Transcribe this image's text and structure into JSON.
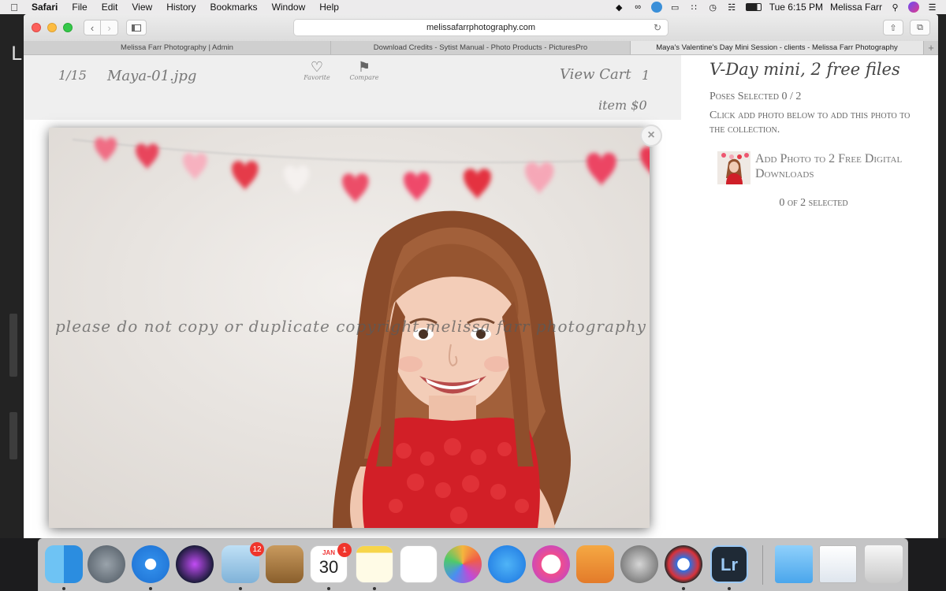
{
  "menubar": {
    "apple_icon": "apple-logo",
    "items": [
      "Safari",
      "File",
      "Edit",
      "View",
      "History",
      "Bookmarks",
      "Window",
      "Help"
    ],
    "clock": "Tue 6:15 PM",
    "user": "Melissa Farr",
    "status_icons": [
      "evernote-icon",
      "creative-cloud-icon",
      "sync-icon",
      "airplay-icon",
      "grid-icon",
      "time-machine-icon",
      "wifi-icon",
      "battery-icon",
      "search-icon",
      "siri-icon",
      "list-icon"
    ]
  },
  "browser": {
    "url": "melissafarrphotography.com",
    "tabs": [
      {
        "label": "Melissa Farr Photography | Admin",
        "active": false
      },
      {
        "label": "Download Credits - Sytist Manual - Photo Products - PicturesPro",
        "active": false
      },
      {
        "label": "Maya's Valentine's Day Mini Session - clients - Melissa Farr Photography",
        "active": true
      }
    ],
    "new_tab_symbol": "+"
  },
  "viewer": {
    "counter": "1/15",
    "filename": "Maya-01.jpg",
    "favorite_label": "Favorite",
    "compare_label": "Compare",
    "view_cart_label": "View Cart",
    "cart_count": "1",
    "cart_summary": "item $0",
    "watermark": "please do not copy or duplicate   copyright melissa farr photography",
    "close_symbol": "×",
    "next_symbol": "›"
  },
  "panel": {
    "title": "V-Day mini, 2 free files",
    "poses_selected": "Poses Selected 0 / 2",
    "instructions": "Click add photo below to add this photo to the collection.",
    "add_photo_label": "Add Photo to 2 Free Digital Downloads",
    "selected_count": "0 of 2 selected"
  },
  "dock": {
    "apps": [
      {
        "name": "Finder",
        "icon": "finder-icon",
        "running": true
      },
      {
        "name": "Launchpad",
        "icon": "launchpad-icon",
        "running": false
      },
      {
        "name": "Safari",
        "icon": "safari-icon",
        "running": true
      },
      {
        "name": "Siri",
        "icon": "siri-icon",
        "running": false
      },
      {
        "name": "Mail",
        "icon": "mail-icon",
        "running": true,
        "badge": "12"
      },
      {
        "name": "Contacts",
        "icon": "contacts-icon",
        "running": false
      },
      {
        "name": "Calendar",
        "icon": "calendar-icon",
        "running": true,
        "badge": "1",
        "month": "JAN",
        "day": "30"
      },
      {
        "name": "Notes",
        "icon": "notes-icon",
        "running": true
      },
      {
        "name": "Reminders",
        "icon": "reminders-icon",
        "running": false
      },
      {
        "name": "Photos",
        "icon": "photos-icon",
        "running": false
      },
      {
        "name": "App Store",
        "icon": "app-store-icon",
        "running": false
      },
      {
        "name": "iTunes",
        "icon": "itunes-icon",
        "running": false
      },
      {
        "name": "Pages",
        "icon": "pages-icon",
        "running": false
      },
      {
        "name": "System Preferences",
        "icon": "system-preferences-icon",
        "running": false
      },
      {
        "name": "Photo Mechanic",
        "icon": "aperture-icon",
        "running": true
      },
      {
        "name": "Lightroom",
        "icon": "lightroom-icon",
        "running": true,
        "text": "Lr"
      },
      {
        "name": "Downloads",
        "icon": "folder-icon",
        "running": false
      },
      {
        "name": "Recent Documents",
        "icon": "documents-stack-icon",
        "running": false
      },
      {
        "name": "Trash",
        "icon": "trash-icon",
        "running": false
      }
    ]
  }
}
